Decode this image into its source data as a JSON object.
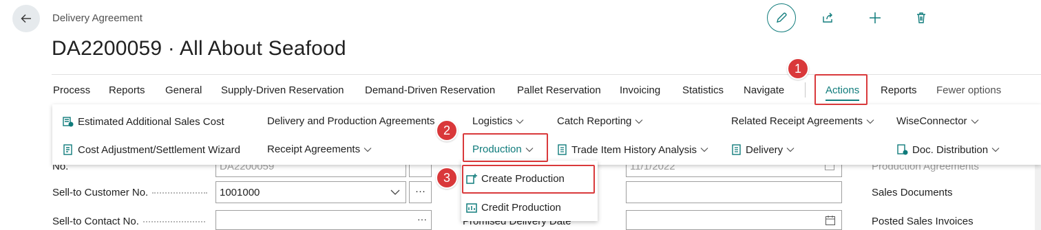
{
  "header": {
    "breadcrumb": "Delivery Agreement",
    "title": "DA2200059 · All About Seafood"
  },
  "icons": {
    "back": "arrow-left-icon",
    "edit": "pencil-icon",
    "share": "share-icon",
    "new": "plus-icon",
    "delete": "trash-icon"
  },
  "actionbar": {
    "tabs": [
      {
        "label": "Process"
      },
      {
        "label": "Reports"
      },
      {
        "label": "General"
      },
      {
        "label": "Supply-Driven Reservation"
      },
      {
        "label": "Demand-Driven Reservation"
      },
      {
        "label": "Pallet Reservation"
      },
      {
        "label": "Invoicing"
      },
      {
        "label": "Statistics"
      },
      {
        "label": "Navigate"
      },
      {
        "label": "Actions"
      },
      {
        "label": "Reports"
      },
      {
        "label": "Fewer options"
      }
    ]
  },
  "actions_panel": {
    "estimated_cost": "Estimated Additional Sales Cost",
    "cost_adjustment": "Cost Adjustment/Settlement Wizard",
    "delivery_production": "Delivery and Production Agreements",
    "receipt_agreements": "Receipt Agreements",
    "logistics": "Logistics",
    "production": "Production",
    "catch_reporting": "Catch Reporting",
    "trade_item_history": "Trade Item History Analysis",
    "related_receipt": "Related Receipt Agreements",
    "delivery": "Delivery",
    "wiseconnector": "WiseConnector",
    "doc_distribution": "Doc. Distribution"
  },
  "production_submenu": {
    "create": "Create Production",
    "credit": "Credit Production"
  },
  "form": {
    "no_label": "No.",
    "no_value": "DA2200059",
    "date_value": "11/1/2022",
    "sell_to_customer_label": "Sell-to Customer No.",
    "sell_to_customer_value": "1001000",
    "sell_to_contact_label": "Sell-to Contact No.",
    "promised_delivery_label": "Promised Delivery Date",
    "ellipsis": "···"
  },
  "factbox": {
    "production_agreements": "Production Agreements",
    "sales_documents": "Sales Documents",
    "posted_sales_invoices": "Posted Sales Invoices"
  },
  "annotations": {
    "step1": "1",
    "step2": "2",
    "step3": "3"
  },
  "colors": {
    "accent": "#0f7b7b",
    "highlight": "#d9383a"
  }
}
